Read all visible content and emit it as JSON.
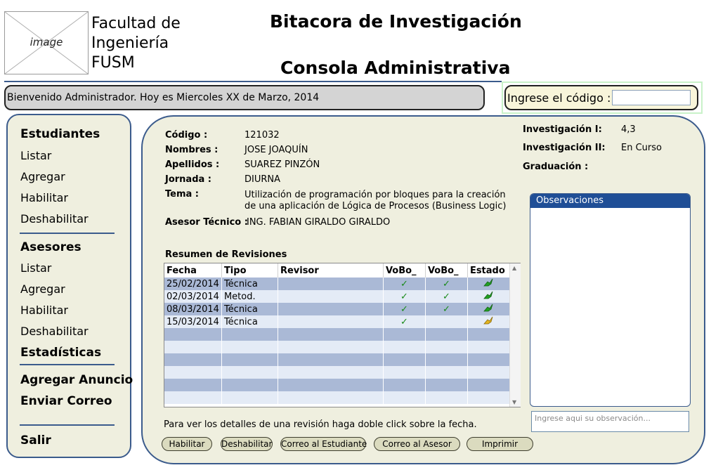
{
  "header": {
    "logo_label": "image",
    "faculty_lines": [
      "Facultad de",
      "Ingeniería",
      "FUSM"
    ],
    "app_title": "Bitacora de Investigación",
    "console_title": "Consola Administrativa"
  },
  "welcome_text": "Bienvenido Administrador. Hoy es Miercoles XX de Marzo, 2014",
  "code_search": {
    "label": "Ingrese el código :",
    "value": ""
  },
  "menu": {
    "estudiantes": "Estudiantes",
    "est_listar": "Listar",
    "est_agregar": "Agregar",
    "est_habilitar": "Habilitar",
    "est_deshabilitar": "Deshabilitar",
    "asesores": "Asesores",
    "as_listar": "Listar",
    "as_agregar": "Agregar",
    "as_habilitar": "Habilitar",
    "as_deshabilitar": "Deshabilitar",
    "estadisticas": "Estadísticas",
    "agregar_anuncio": "Agregar Anuncio",
    "enviar_correo": "Enviar Correo",
    "salir": "Salir"
  },
  "student": {
    "codigo_label": "Código :",
    "codigo": "121032",
    "nombres_label": "Nombres :",
    "nombres": "JOSE JOAQUÍN",
    "apellidos_label": "Apellidos :",
    "apellidos": "SUAREZ PINZÓN",
    "jornada_label": "Jornada :",
    "jornada": "DIURNA",
    "tema_label": "Tema :",
    "tema_line1": "Utilización de programación por bloques para la creación",
    "tema_line2": "de una aplicación de Lógica de Procesos (Business Logic)",
    "asesor_label": "Asesor Técnico :",
    "asesor": "ING. FABIAN GIRALDO GIRALDO"
  },
  "status": {
    "inv1_label": "Investigación I:",
    "inv1": "4,3",
    "inv2_label": "Investigación II:",
    "inv2": "En Curso",
    "grad_label": "Graduación :",
    "grad": ""
  },
  "revisions": {
    "title": "Resumen de Revisiones",
    "columns": [
      "Fecha",
      "Tipo",
      "Revisor",
      "VoBo_",
      "VoBo_",
      "Estado"
    ],
    "rows": [
      {
        "fecha": "25/02/2014",
        "tipo": "Técnica",
        "revisor": "",
        "vobo1": "✓",
        "vobo2": "✓",
        "estado": "approved"
      },
      {
        "fecha": "02/03/2014",
        "tipo": "Metod.",
        "revisor": "",
        "vobo1": "✓",
        "vobo2": "✓",
        "estado": "approved"
      },
      {
        "fecha": "08/03/2014",
        "tipo": "Técnica",
        "revisor": "",
        "vobo1": "✓",
        "vobo2": "✓",
        "estado": "approved"
      },
      {
        "fecha": "15/03/2014",
        "tipo": "Técnica",
        "revisor": "",
        "vobo1": "✓",
        "vobo2": "",
        "estado": "pending"
      }
    ],
    "hint": "Para ver los detalles de una revisión haga doble click sobre la fecha."
  },
  "observations": {
    "title": "Observaciones",
    "placeholder": "Ingrese aqui su observación..."
  },
  "buttons": {
    "habilitar": "Habilitar",
    "deshabilitar": "Deshabilitar",
    "correo_estudiante": "Correo al Estudiante",
    "correo_asesor": "Correo al Asesor",
    "imprimir": "Imprimir"
  },
  "colors": {
    "accent": "#3b5b8c",
    "panel_bg": "#efefdf",
    "row_blue": "#aab9d6",
    "obs_header": "#1f4e96",
    "approved": "#22a022",
    "pending": "#d4a017"
  }
}
